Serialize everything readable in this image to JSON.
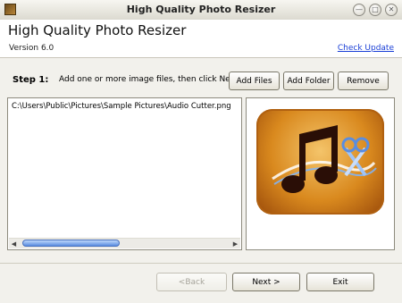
{
  "window": {
    "title": "High Quality Photo Resizer",
    "buttons": {
      "minimize": "—",
      "maximize": "□",
      "close": "✕"
    }
  },
  "header": {
    "app_title": "High Quality Photo Resizer",
    "version": "Version 6.0",
    "check_update": "Check Update"
  },
  "step": {
    "label": "Step 1:",
    "description": "Add one or more image files, then click Next."
  },
  "toolbar": {
    "add_files": "Add Files",
    "add_folder": "Add Folder",
    "remove": "Remove"
  },
  "file_list": {
    "items": [
      "C:\\Users\\Public\\Pictures\\Sample Pictures\\Audio Cutter.png"
    ]
  },
  "preview": {
    "icon": "audio-cutter-music-note-scissors-icon"
  },
  "scrollbar": {
    "left_arrow": "◀",
    "right_arrow": "▶"
  },
  "nav": {
    "back": "<Back",
    "next": "Next >",
    "exit": "Exit"
  },
  "colors": {
    "link": "#1a3fd6",
    "accent_orange": "#d9891e",
    "scroll_thumb": "#5a8de0"
  }
}
